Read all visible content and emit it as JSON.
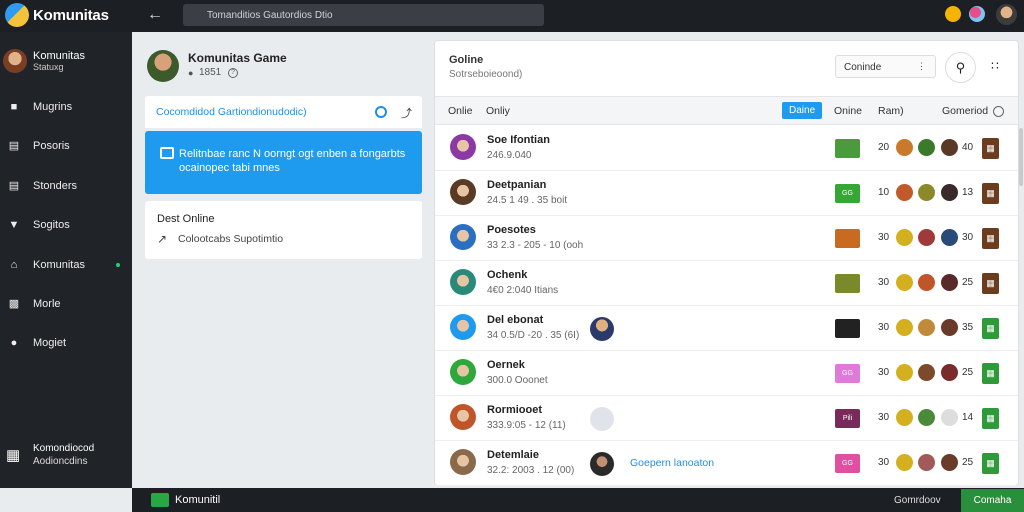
{
  "topbar": {
    "app_title": "Komunitas",
    "search_placeholder": "Tomanditios Gautordios Dtio",
    "icons": [
      "logo-icon",
      "back-icon",
      "search-icon",
      "notification-icon",
      "status-icon",
      "avatar"
    ]
  },
  "sidebar": {
    "user": {
      "name": "Komunitas",
      "sub": "Statuxg"
    },
    "items": [
      {
        "label": "Mugrins",
        "icon": "forum-icon"
      },
      {
        "label": "Posoris",
        "icon": "document-icon"
      },
      {
        "label": "Stonders",
        "icon": "list-icon"
      },
      {
        "label": "Sogitos",
        "icon": "shield-icon"
      },
      {
        "label": "Komunitas",
        "icon": "home-icon",
        "active_dot": true
      },
      {
        "label": "Morle",
        "icon": "chart-icon"
      },
      {
        "label": "Mogiet",
        "icon": "info-icon"
      }
    ],
    "footer": {
      "line1": "Komondiocod",
      "line2": "Aodioncdins"
    }
  },
  "game": {
    "title": "Komunitas Game",
    "meta": "1851"
  },
  "link_row": {
    "label": "Cocomdidod Gartiondionudodic)"
  },
  "info_box": {
    "text": "Relitnbae ranc N oorngt ogt enben a fongarbts ocainopec tabi mnes"
  },
  "dev_box": {
    "title": "Dest Online",
    "sub": "Colootcabs Supotimtio"
  },
  "main": {
    "title": "Goline",
    "subtitle": "Sotrseboieoond)",
    "select_value": "Coninde",
    "columns": {
      "c1": "Onlie",
      "c2": "Onliy",
      "badge": "Daine",
      "c3": "Onine",
      "c4": "Ram)",
      "c5": "Gomeriod"
    },
    "rows": [
      {
        "name": "Soe Ifontian",
        "sub": "246.9.040",
        "tag_color": "#4a9b3b",
        "tag_text": "",
        "num": "20",
        "num2": "40",
        "act_color": "#6b3c1e"
      },
      {
        "name": "Deetpanian",
        "sub": "24.5 1 49 . 35 boit",
        "tag_color": "#36a635",
        "tag_text": "GG",
        "num": "10",
        "num2": "13",
        "act_color": "#6b3c1e"
      },
      {
        "name": "Poesotes",
        "sub": "33 2.3 - 205 - 10 (ooh",
        "tag_color": "#c86b20",
        "tag_text": "",
        "num": "30",
        "num2": "30",
        "act_color": "#6b3c1e"
      },
      {
        "name": "Ochenk",
        "sub": "4€0 2:040 Itians",
        "tag_color": "#7a8a2a",
        "tag_text": "",
        "num": "30",
        "num2": "25",
        "act_color": "#6b3c1e"
      },
      {
        "name": "Del ebonat",
        "sub": "34 0.5/D -20 . 35 (6I)",
        "tag_color": "#222222",
        "tag_text": "",
        "num": "30",
        "num2": "35",
        "act_color": "#2e9a3a"
      },
      {
        "name": "Oernek",
        "sub": "300.0 Ooonet",
        "tag_color": "#e07ad8",
        "tag_text": "GG",
        "num": "30",
        "num2": "25",
        "act_color": "#2e9a3a"
      },
      {
        "name": "Rormiooet",
        "sub": "333.9:05 - 12 (11)",
        "tag_color": "#7a2a5a",
        "tag_text": "Pili",
        "num": "30",
        "num2": "14",
        "act_color": "#2e9a3a"
      },
      {
        "name": "Detemlaie",
        "sub": "32.2: 2003 . 12 (00)",
        "tag_color": "#e04fa0",
        "tag_text": "GG",
        "num": "30",
        "num2": "25",
        "act_color": "#2e9a3a",
        "extra_link": "Goepern lanoaton"
      }
    ]
  },
  "bottombar": {
    "label": "Komunitil",
    "status": "Gomrdoov",
    "button": "Comaha"
  }
}
